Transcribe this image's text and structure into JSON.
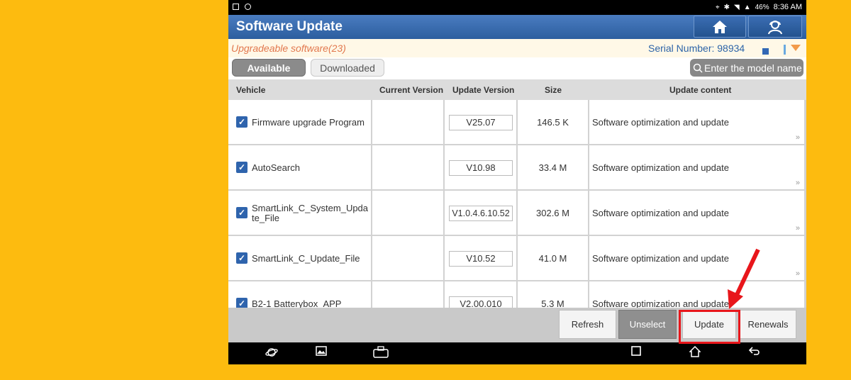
{
  "status": {
    "battery": "46%",
    "time": "8:36 AM"
  },
  "app": {
    "title": "Software Update"
  },
  "info": {
    "upgradeable": "Upgradeable software(23)",
    "serial_label": "Serial Number:",
    "serial_value": "98934"
  },
  "tabs": {
    "available": "Available",
    "downloaded": "Downloaded"
  },
  "search": {
    "placeholder": "Enter the model name"
  },
  "columns": {
    "vehicle": "Vehicle",
    "current": "Current Version",
    "update": "Update Version",
    "size": "Size",
    "content": "Update content"
  },
  "rows": [
    {
      "name": "Firmware upgrade Program",
      "current": "",
      "update": "V25.07",
      "size": "146.5 K",
      "content": "Software optimization and update",
      "checked": true
    },
    {
      "name": "AutoSearch",
      "current": "",
      "update": "V10.98",
      "size": "33.4 M",
      "content": "Software optimization and update",
      "checked": true
    },
    {
      "name": "SmartLink_C_System_Update_File",
      "current": "",
      "update": "V1.0.4.6.10.52",
      "size": "302.6 M",
      "content": "Software optimization and update",
      "checked": true
    },
    {
      "name": "SmartLink_C_Update_File",
      "current": "",
      "update": "V10.52",
      "size": "41.0 M",
      "content": "Software optimization and update",
      "checked": true
    },
    {
      "name": "B2-1 Batterybox_APP",
      "current": "",
      "update": "V2.00.010",
      "size": "5.3 M",
      "content": "Software optimization and update",
      "checked": true
    }
  ],
  "footer": {
    "refresh": "Refresh",
    "unselect": "Unselect",
    "update": "Update",
    "renewals": "Renewals"
  },
  "colors": {
    "background": "#FDBB0F",
    "titlebar": "#2c5e9f",
    "highlight": "#e8161b"
  }
}
